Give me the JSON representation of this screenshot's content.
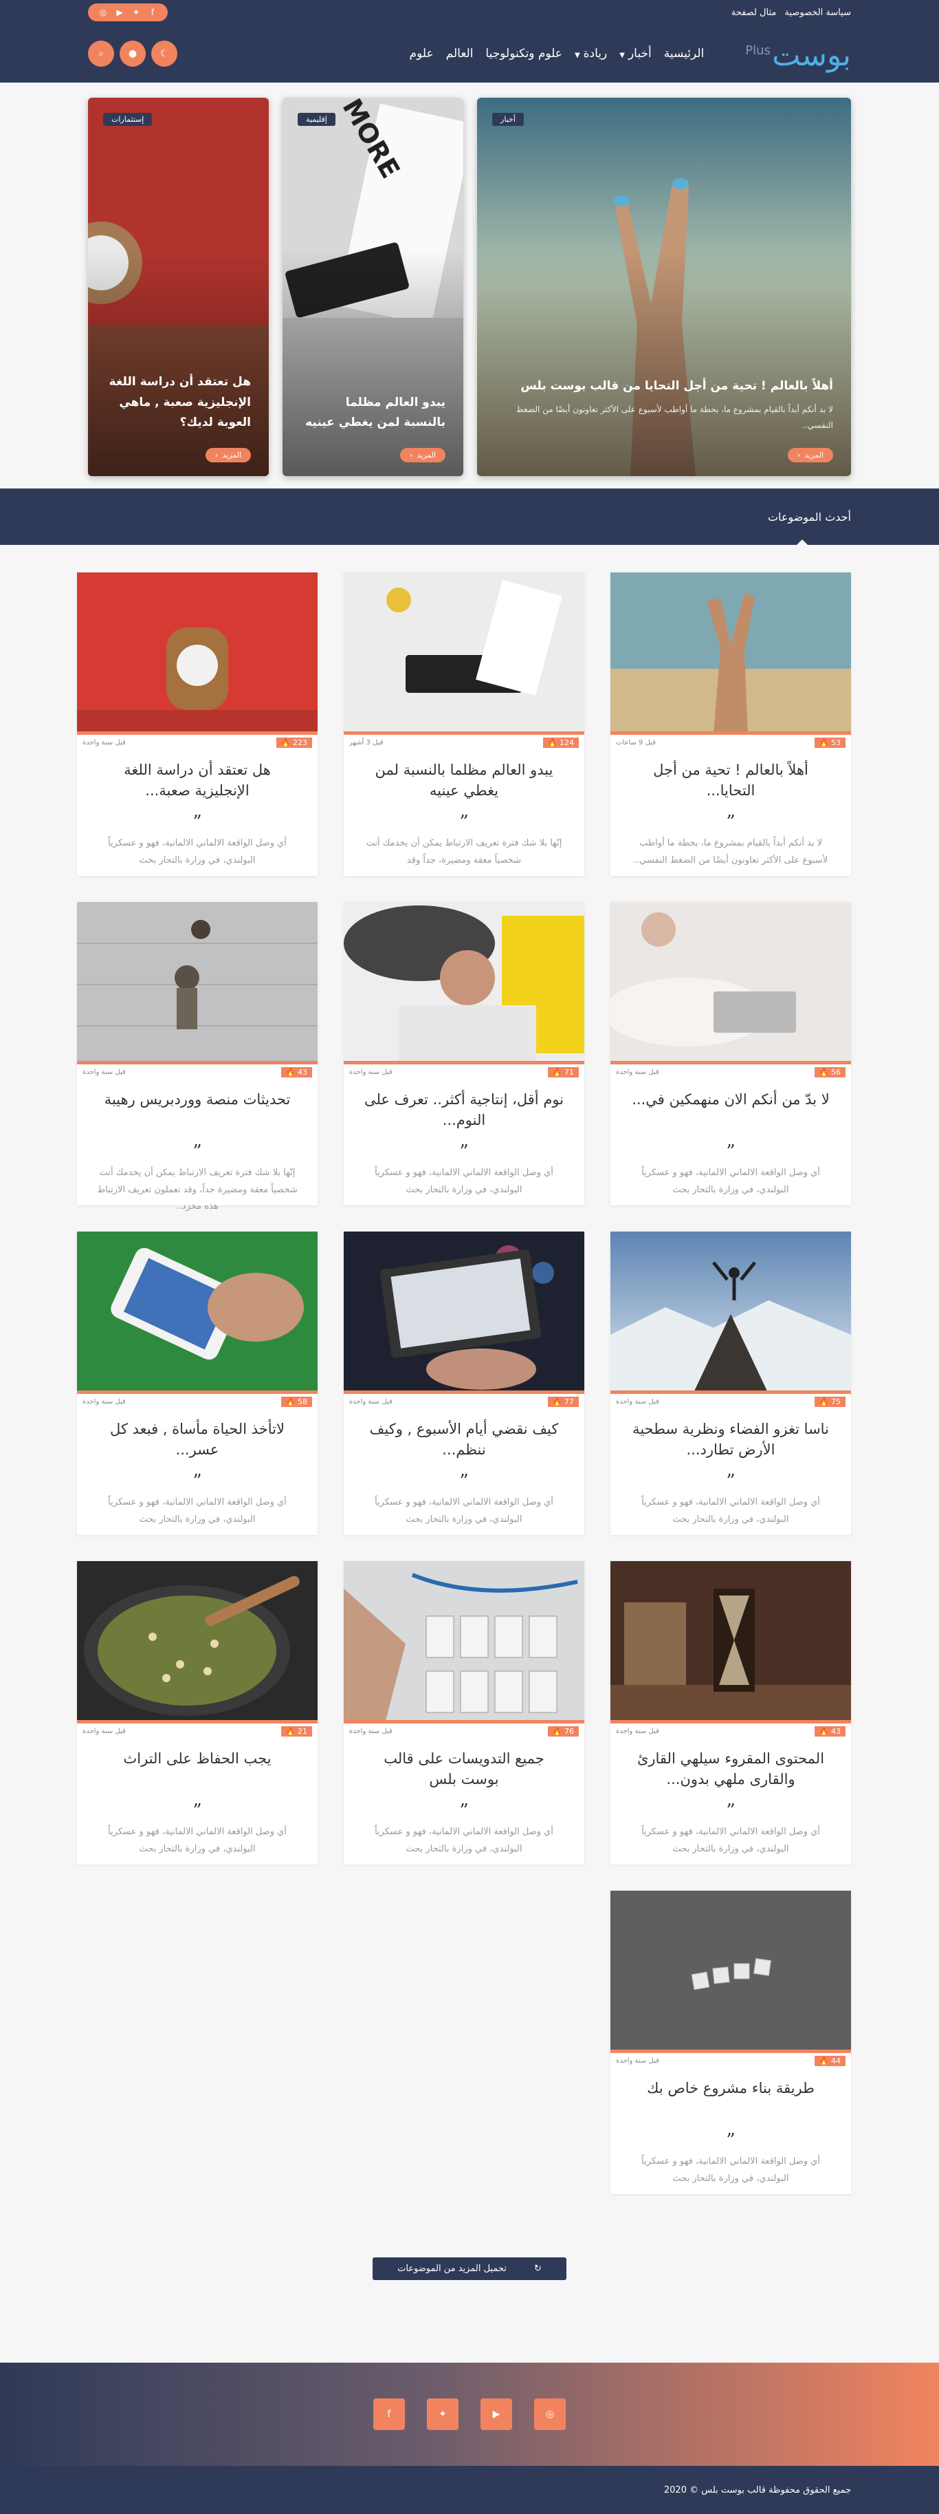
{
  "topbar": {
    "links": [
      "سياسة الخصوصية",
      "مثال لصفحة"
    ],
    "social_icons": [
      "facebook-icon",
      "twitter-icon",
      "youtube-icon",
      "instagram-icon"
    ]
  },
  "header": {
    "logo_text": "بوست",
    "logo_plus": "Plus",
    "nav": [
      {
        "label": "الرئيسية",
        "dropdown": false
      },
      {
        "label": "أخبار",
        "dropdown": true
      },
      {
        "label": "ريادة",
        "dropdown": true
      },
      {
        "label": "علوم وتكنولوجيا",
        "dropdown": false
      },
      {
        "label": "العالم",
        "dropdown": false
      },
      {
        "label": "علوم",
        "dropdown": false
      }
    ],
    "buttons": [
      "moon-icon",
      "user-icon",
      "search-icon"
    ]
  },
  "featured": [
    {
      "tag": "أخبار",
      "title": "أهلاً بالعالم ! تحية من أجل التحايا من قالب بوست بلس",
      "excerpt": "لا بد أنكم أبداً بالقيام بمشروع ما، بخطة ما أواطب لأسبوع على الأكثر تعاونون أيضًا من الضغط النفسي..",
      "more": "المزيد"
    },
    {
      "tag": "إقليمية",
      "title": "يبدو العالم مظلما بالنسبة لمن يغطي عينيه",
      "excerpt": "",
      "more": "المزيد"
    },
    {
      "tag": "إستثمارات",
      "title": "هل تعتقد أن دراسة اللغة الإنجليزية صعبة , ماهي العوبة لديك؟",
      "excerpt": "",
      "more": "المزيد"
    }
  ],
  "section": {
    "title": "أحدث الموضوعات"
  },
  "posts": [
    {
      "title": "أهلاً بالعالم ! تحية من أجل التحايا...",
      "date": "قبل 9 ساعات",
      "views": "53",
      "excerpt": "لا بد أنكم أبداً بالقيام بمشروع ما، بخطة ما أواطب لأسبوع على الأكثر تعاونون أيضًا من الضغط النفسي.."
    },
    {
      "title": "يبدو العالم مظلما بالنسبة لمن يغطي عينيه",
      "date": "قبل 3 أشهر",
      "views": "124",
      "excerpt": "إنّها بلا شك فترة تعريف الارتباط يمكن أن يخدمك أنت شخصياً معقة ومضيرة، جداً وقد"
    },
    {
      "title": "هل تعتقد أن دراسة اللغة الإنجليزية صعبة...",
      "date": "قبل سنة واحدة",
      "views": "223",
      "excerpt": "أي وصل الواقعة الالماني الالمانية، فهو و عسكرياً البولندي، في وزارة بالتحار بحث"
    },
    {
      "title": "لا بدّ من أنكم الان منهمكين في...",
      "date": "قبل سنة واحدة",
      "views": "56",
      "excerpt": "أي وصل الواقعة الالماني الالمانية، فهو و عسكرياً البولندي، في وزارة بالتحار بحث"
    },
    {
      "title": "نوم أقل، إنتاجية أكثر.. تعرف على النوم...",
      "date": "قبل سنة واحدة",
      "views": "71",
      "excerpt": "أي وصل الواقعة الالماني الالمانية، فهو و عسكرياً البولندي، في وزارة بالتحار بحث"
    },
    {
      "title": "تحديثات منصة ووردبريس رهيبة",
      "date": "قبل سنة واحدة",
      "views": "43",
      "excerpt": "إنّها بلا شك فترة تعريف الارتباط يمكن أن يخدمك أنت شخصياً معقة ومضيرة جداً، وقد تعملون تعريف الارتباط هذه مخزد.."
    },
    {
      "title": "ناسا تغزو الفضاء ونظرية سطحية الأرض تطارد...",
      "date": "قبل سنة واحدة",
      "views": "75",
      "excerpt": "أي وصل الواقعة الالماني الالمانية، فهو و عسكرياً البولندي، في وزارة بالتحار بحث"
    },
    {
      "title": "كيف نقضي أيام الأسبوع , وكيف ننظم...",
      "date": "قبل سنة واحدة",
      "views": "77",
      "excerpt": "أي وصل الواقعة الالماني الالمانية، فهو و عسكرياً البولندي، في وزارة بالتحار بحث"
    },
    {
      "title": "لاتأخذ الحياة مأساة , فبعد كل عسر...",
      "date": "قبل سنة واحدة",
      "views": "58",
      "excerpt": "أي وصل الواقعة الالماني الالمانية، فهو و عسكرياً البولندي، في وزارة بالتحار بحث"
    },
    {
      "title": "المحتوى المقروء سيلهي القارئ والقارى ملهي بدون...",
      "date": "قبل سنة واحدة",
      "views": "43",
      "excerpt": "أي وصل الواقعة الالماني الالمانية، فهو و عسكرياً البولندي، في وزارة بالتحار بحث"
    },
    {
      "title": "جميع التدويسات على قالب بوست بلس",
      "date": "قبل سنة واحدة",
      "views": "76",
      "excerpt": "أي وصل الواقعة الالماني الالمانية، فهو و عسكرياً البولندي، في وزارة بالتحار بحث"
    },
    {
      "title": "يجب الحفاظ على التراث",
      "date": "قبل سنة واحدة",
      "views": "21",
      "excerpt": "أي وصل الواقعة الالماني الالمانية، فهو و عسكرياً البولندي، في وزارة بالتحار بحث"
    },
    {
      "title": "طريقة بناء مشروع خاص بك",
      "date": "قبل سنة واحدة",
      "views": "44",
      "excerpt": "أي وصل الواقعة الالماني الالمانية، فهو و عسكرياً البولندي، في وزارة بالتحار بحث"
    }
  ],
  "load_more": "تحميل المزيد من الموضوعات",
  "footer": {
    "social_icons": [
      "facebook-icon",
      "twitter-icon",
      "youtube-icon",
      "instagram-icon"
    ],
    "copyright": "جميع الحقوق محفوظة قالب بوست بلس © 2020"
  },
  "colors": {
    "primary": "#2f3a58",
    "accent": "#f1845f"
  }
}
